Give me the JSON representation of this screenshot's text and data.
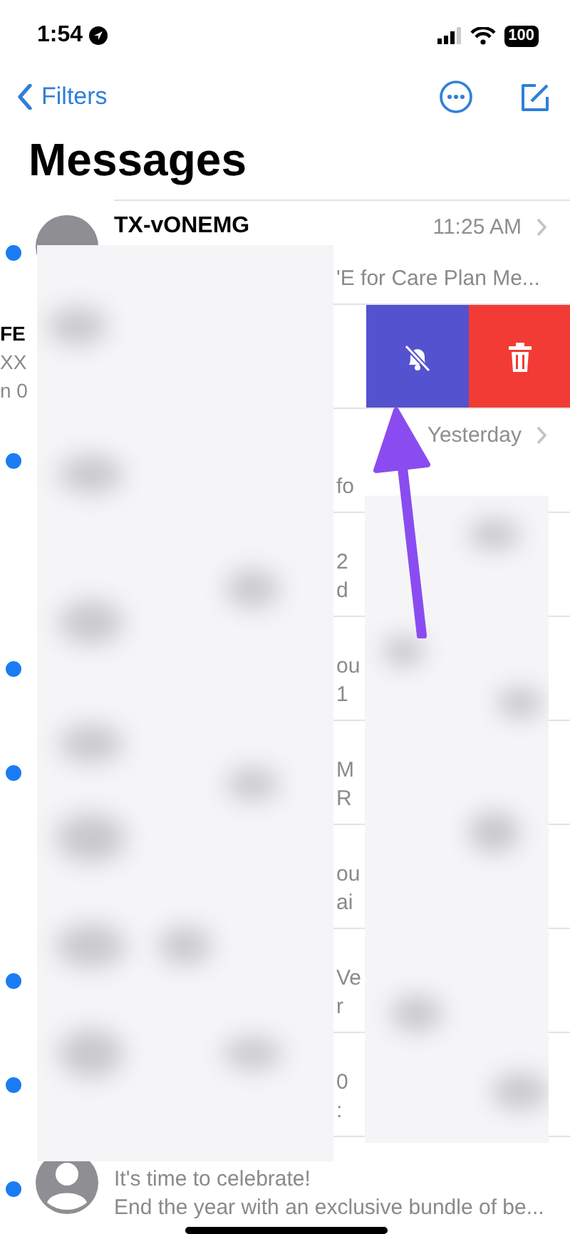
{
  "status_bar": {
    "time": "1:54",
    "battery": "100"
  },
  "nav": {
    "back": "Filters"
  },
  "title": "Messages",
  "conversations": [
    {
      "kind": "partial",
      "unread": true,
      "name": "TX-vONEMG",
      "time": "11:25 AM",
      "lines": [
        "'E for Care Plan Me..."
      ]
    },
    {
      "kind": "swiped",
      "lines": [
        "FE",
        "XX",
        "n 0"
      ],
      "actions": [
        {
          "kind": "mute"
        },
        {
          "kind": "delete"
        }
      ]
    },
    {
      "kind": "partial",
      "unread": true,
      "time": "Yesterday",
      "lines": [
        "fo"
      ]
    },
    {
      "kind": "partial",
      "unread": false,
      "lines": [
        "2",
        "d"
      ]
    },
    {
      "kind": "partial",
      "unread": true,
      "lines": [
        "ou",
        "1"
      ]
    },
    {
      "kind": "partial",
      "unread": true,
      "lines": [
        "M",
        "R"
      ]
    },
    {
      "kind": "partial",
      "unread": false,
      "lines": [
        "ou",
        "ai"
      ]
    },
    {
      "kind": "partial",
      "unread": true,
      "lines": [
        "Ve",
        "r"
      ]
    },
    {
      "kind": "partial",
      "unread": true,
      "lines": [
        "0",
        ":"
      ]
    },
    {
      "kind": "message",
      "unread": true,
      "lines": [
        "It's time to celebrate!",
        "End the year with an exclusive bundle of be..."
      ]
    }
  ]
}
